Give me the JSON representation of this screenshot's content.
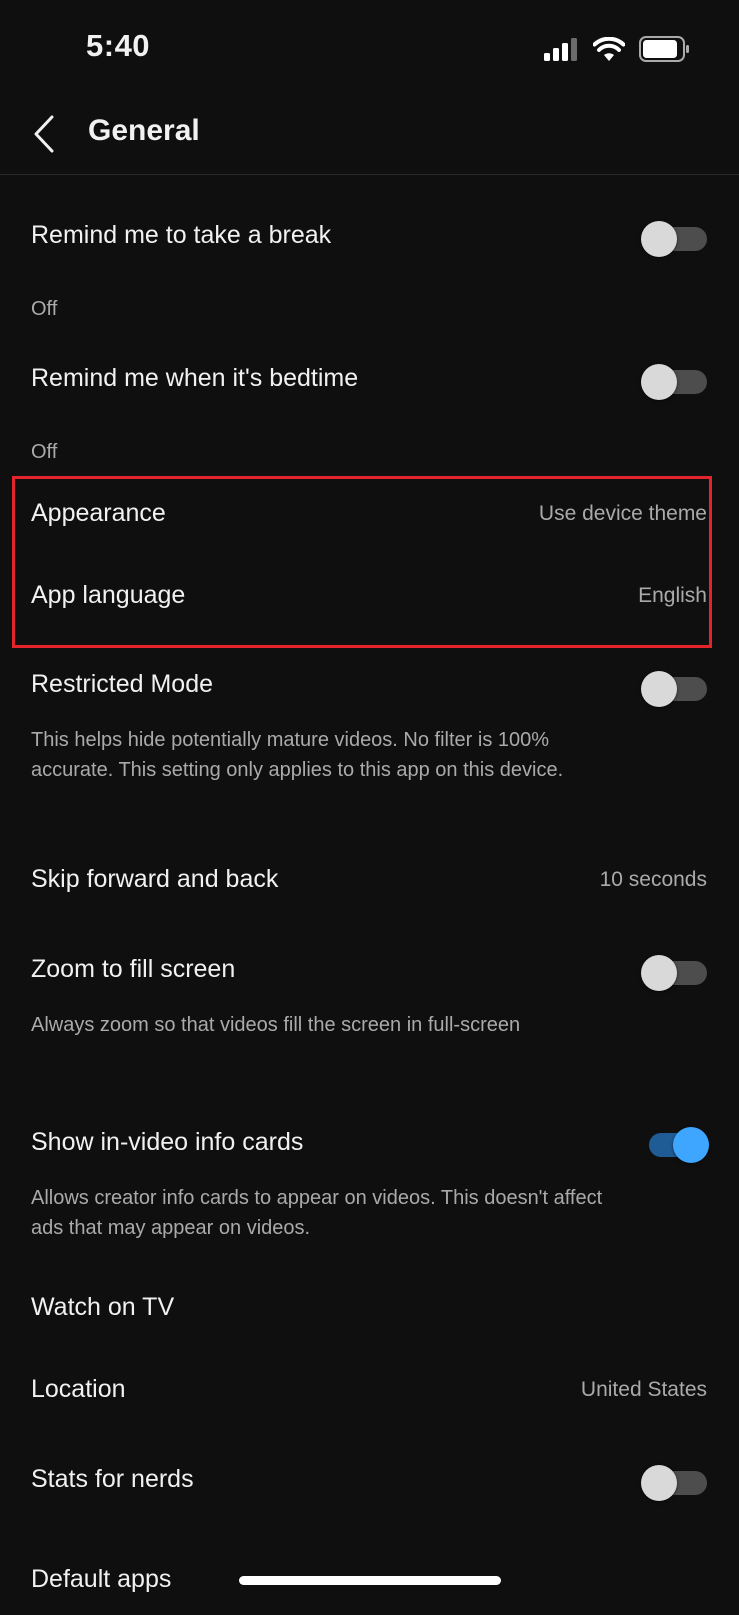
{
  "status_bar": {
    "time": "5:40",
    "icons": [
      "signal-icon",
      "wifi-icon",
      "battery-icon"
    ]
  },
  "header": {
    "back_icon": "chevron-left-icon",
    "title": "General"
  },
  "settings": [
    {
      "id": "remind-break",
      "label": "Remind me to take a break",
      "subtitle": "Off",
      "control": "toggle",
      "on": false
    },
    {
      "id": "remind-bedtime",
      "label": "Remind me when it's bedtime",
      "subtitle": "Off",
      "control": "toggle",
      "on": false
    },
    {
      "id": "appearance",
      "label": "Appearance",
      "value": "Use device theme"
    },
    {
      "id": "app-language",
      "label": "App language",
      "value": "English"
    },
    {
      "id": "restricted-mode",
      "label": "Restricted Mode",
      "subtitle": "This helps hide potentially mature videos. No filter is 100% accurate. This setting only applies to this app on this device.",
      "control": "toggle",
      "on": false,
      "highlighted": true
    },
    {
      "id": "skip-forward-back",
      "label": "Skip forward and back",
      "value": "10 seconds"
    },
    {
      "id": "zoom-fill",
      "label": "Zoom to fill screen",
      "subtitle": "Always zoom so that videos fill the screen in full-screen",
      "control": "toggle",
      "on": false
    },
    {
      "id": "info-cards",
      "label": "Show in-video info cards",
      "subtitle": "Allows creator info cards to appear on videos. This doesn't affect ads that may appear on videos.",
      "control": "toggle",
      "on": true
    },
    {
      "id": "watch-on-tv",
      "label": "Watch on TV"
    },
    {
      "id": "location",
      "label": "Location",
      "value": "United States"
    },
    {
      "id": "stats-for-nerds",
      "label": "Stats for nerds",
      "control": "toggle",
      "on": false
    },
    {
      "id": "default-apps",
      "label": "Default apps"
    }
  ],
  "colors": {
    "background": "#0f0f0f",
    "toggle_on": "#3ea6ff",
    "highlight_border": "#e3242b"
  }
}
